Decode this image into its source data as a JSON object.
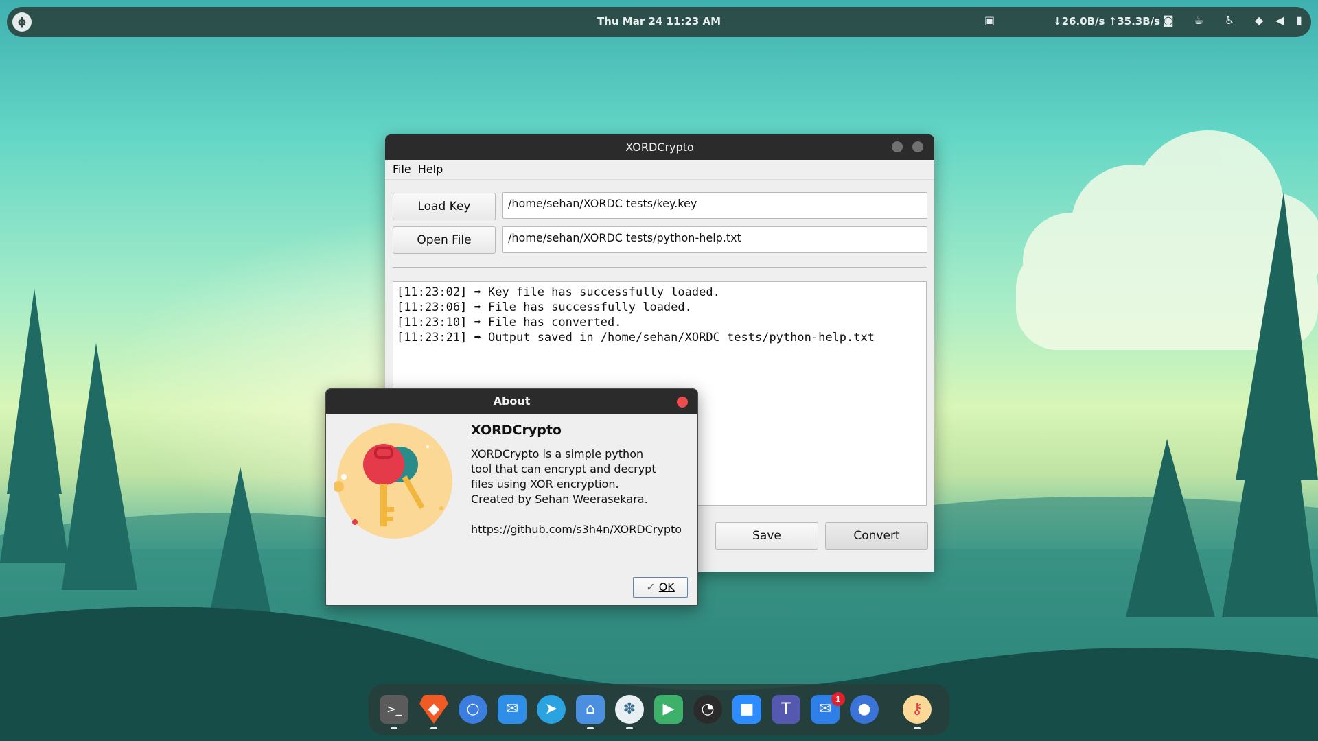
{
  "topbar": {
    "clock": "Thu Mar 24  11:23 AM",
    "network_speed": "↓26.0B/s ↑35.3B/s"
  },
  "main_window": {
    "title": "XORDCrypto",
    "menu": [
      "File",
      "Help"
    ],
    "load_key_label": "Load Key",
    "key_path": "/home/sehan/XORDC tests/key.key",
    "open_file_label": "Open File",
    "file_path": "/home/sehan/XORDC tests/python-help.txt",
    "log_lines": [
      "[11:23:02] ➡ Key file has successfully loaded.",
      "[11:23:06] ➡ File has successfully loaded.",
      "[11:23:10] ➡ File has converted.",
      "[11:23:21] ➡ Output saved in /home/sehan/XORDC tests/python-help.txt"
    ],
    "save_label": "Save",
    "convert_label": "Convert"
  },
  "about_dialog": {
    "title": "About",
    "heading": "XORDCrypto",
    "description_lines": [
      "XORDCrypto is a simple python",
      "tool that can encrypt and decrypt",
      "files using XOR encryption."
    ],
    "author": "Created by Sehan Weerasekara.",
    "url": "https://github.com/s3h4n/XORDCrypto",
    "ok_label": "OK"
  },
  "dock": {
    "items": [
      "terminal-icon",
      "brave-icon",
      "chromium-icon",
      "mail-icon",
      "telegram-icon",
      "files-icon",
      "app-icon",
      "media-player-icon",
      "obs-icon",
      "zoom-icon",
      "teams-icon",
      "mailspring-icon",
      "toggle-icon",
      "xordcrypto-icon"
    ],
    "mail_badge": "1"
  },
  "colors": {
    "titlebar": "#2b2b2b",
    "window_bg": "#efefef",
    "close_red": "#ee4c4c",
    "accent_blue": "#5d86b8"
  }
}
